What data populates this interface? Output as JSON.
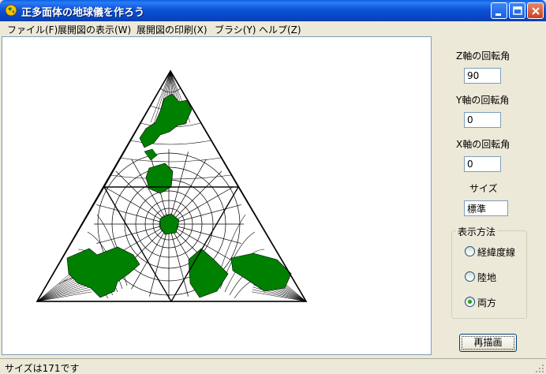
{
  "window": {
    "title": "正多面体の地球儀を作ろう"
  },
  "menu": [
    {
      "label": "ファイル(F)"
    },
    {
      "label": "展開図の表示(W)"
    },
    {
      "label": "展開図の印刷(X)"
    },
    {
      "label": "ブラシ(Y)"
    },
    {
      "label": "ヘルプ(Z)"
    }
  ],
  "controls": {
    "z_label": "Z軸の回転角",
    "z_value": "90",
    "y_label": "Y軸の回転角",
    "y_value": "0",
    "x_label": "X軸の回転角",
    "x_value": "0",
    "size_label": "サイズ",
    "size_value": "標準"
  },
  "display_mode": {
    "title": "表示方法",
    "options": [
      {
        "label": "経緯度線",
        "selected": false
      },
      {
        "label": "陸地",
        "selected": false
      },
      {
        "label": "両方",
        "selected": true
      }
    ]
  },
  "redraw_label": "再描画",
  "status": "サイズは171です",
  "colors": {
    "land": "#008000",
    "title_bar": "#0a53d8"
  }
}
